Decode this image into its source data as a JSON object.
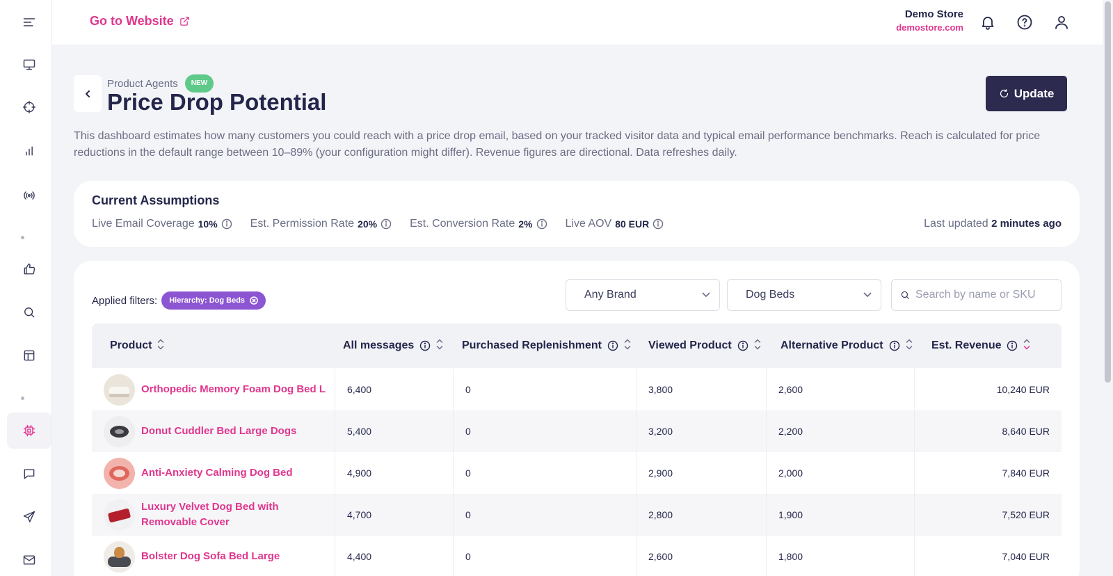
{
  "header": {
    "go_to_website": "Go to Website",
    "store_name": "Demo Store",
    "store_domain": "demostore.com"
  },
  "sidebar": {
    "items": [
      {
        "icon": "monitor-icon"
      },
      {
        "icon": "crosshair-icon"
      },
      {
        "icon": "bar-chart-icon"
      },
      {
        "icon": "broadcast-icon"
      },
      {
        "icon": "thumbs-up-icon"
      },
      {
        "icon": "search-icon"
      },
      {
        "icon": "layout-icon"
      },
      {
        "icon": "cpu-icon",
        "active": true
      },
      {
        "icon": "message-icon"
      },
      {
        "icon": "send-icon"
      },
      {
        "icon": "mail-icon"
      }
    ]
  },
  "page": {
    "breadcrumb": "Product Agents",
    "badge": "NEW",
    "title": "Price Drop Potential",
    "update_label": "Update",
    "description": "This dashboard estimates how many customers you could reach with a price drop email, based on your tracked visitor data and typical email performance benchmarks. Reach is calculated for price reductions in the default range between 10–89% (your configuration might differ). Revenue figures are directional. Data refreshes daily."
  },
  "assumptions": {
    "title": "Current Assumptions",
    "items": [
      {
        "label": "Live Email Coverage",
        "value": "10%"
      },
      {
        "label": "Est. Permission Rate",
        "value": "20%"
      },
      {
        "label": "Est. Conversion Rate",
        "value": "2%"
      },
      {
        "label": "Live AOV",
        "value": "80 EUR"
      }
    ],
    "last_updated_label": "Last updated",
    "last_updated_value": "2 minutes ago"
  },
  "filters": {
    "applied_label": "Applied filters:",
    "chip": "Hierarchy: Dog Beds",
    "brand_select": "Any Brand",
    "category_select": "Dog Beds",
    "search_placeholder": "Search by name or SKU"
  },
  "table": {
    "columns": [
      "Product",
      "All messages",
      "Purchased Replenishment",
      "Viewed Product",
      "Alternative Product",
      "Est. Revenue"
    ],
    "rows": [
      {
        "product": "Orthopedic Memory Foam Dog Bed L",
        "all": "6,400",
        "purchased": "0",
        "viewed": "3,800",
        "alternative": "2,600",
        "revenue": "10,240 EUR"
      },
      {
        "product": "Donut Cuddler Bed Large Dogs",
        "all": "5,400",
        "purchased": "0",
        "viewed": "3,200",
        "alternative": "2,200",
        "revenue": "8,640 EUR"
      },
      {
        "product": "Anti-Anxiety Calming Dog Bed",
        "all": "4,900",
        "purchased": "0",
        "viewed": "2,900",
        "alternative": "2,000",
        "revenue": "7,840 EUR"
      },
      {
        "product": "Luxury Velvet Dog Bed with Removable Cover",
        "all": "4,700",
        "purchased": "0",
        "viewed": "2,800",
        "alternative": "1,900",
        "revenue": "7,520 EUR"
      },
      {
        "product": "Bolster Dog Sofa Bed Large",
        "all": "4,400",
        "purchased": "0",
        "viewed": "2,600",
        "alternative": "1,800",
        "revenue": "7,040 EUR"
      }
    ]
  },
  "colors": {
    "accent": "#e0368e",
    "primary_dark": "#2c2a4f",
    "badge_green": "#5fc98a",
    "chip_purple": "#8c55d2"
  }
}
